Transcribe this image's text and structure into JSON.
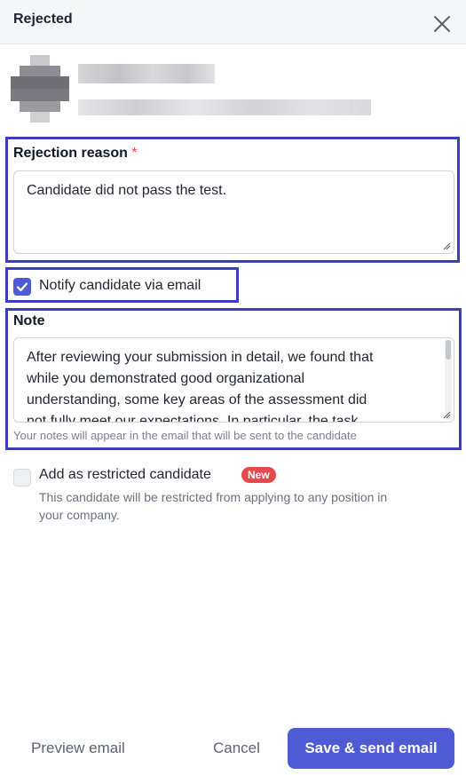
{
  "header": {
    "title": "Rejected",
    "close_icon": "close-icon"
  },
  "rejection": {
    "label": "Rejection reason",
    "required_mark": "*",
    "value": "Candidate did not pass the test."
  },
  "notify": {
    "label": "Notify candidate via email",
    "checked": true
  },
  "note": {
    "label": "Note",
    "lines": [
      "After reviewing your submission in detail, we found that",
      "while you demonstrated good organizational",
      "understanding, some key areas of the assessment did",
      "not fully meet our expectations. In particular, the task"
    ],
    "hint": "Your notes will appear in the email that will be sent to the candidate"
  },
  "restricted": {
    "label": "Add as restricted candidate",
    "badge": "New",
    "description_line1": "This candidate will be restricted from applying to any position in",
    "description_line2": "your company.",
    "checked": false
  },
  "footer": {
    "preview_label": "Preview email",
    "cancel_label": "Cancel",
    "save_label": "Save & send email"
  },
  "colors": {
    "accent": "#4f5bd5",
    "highlight": "#3b3fbf",
    "required": "#e5484d"
  }
}
